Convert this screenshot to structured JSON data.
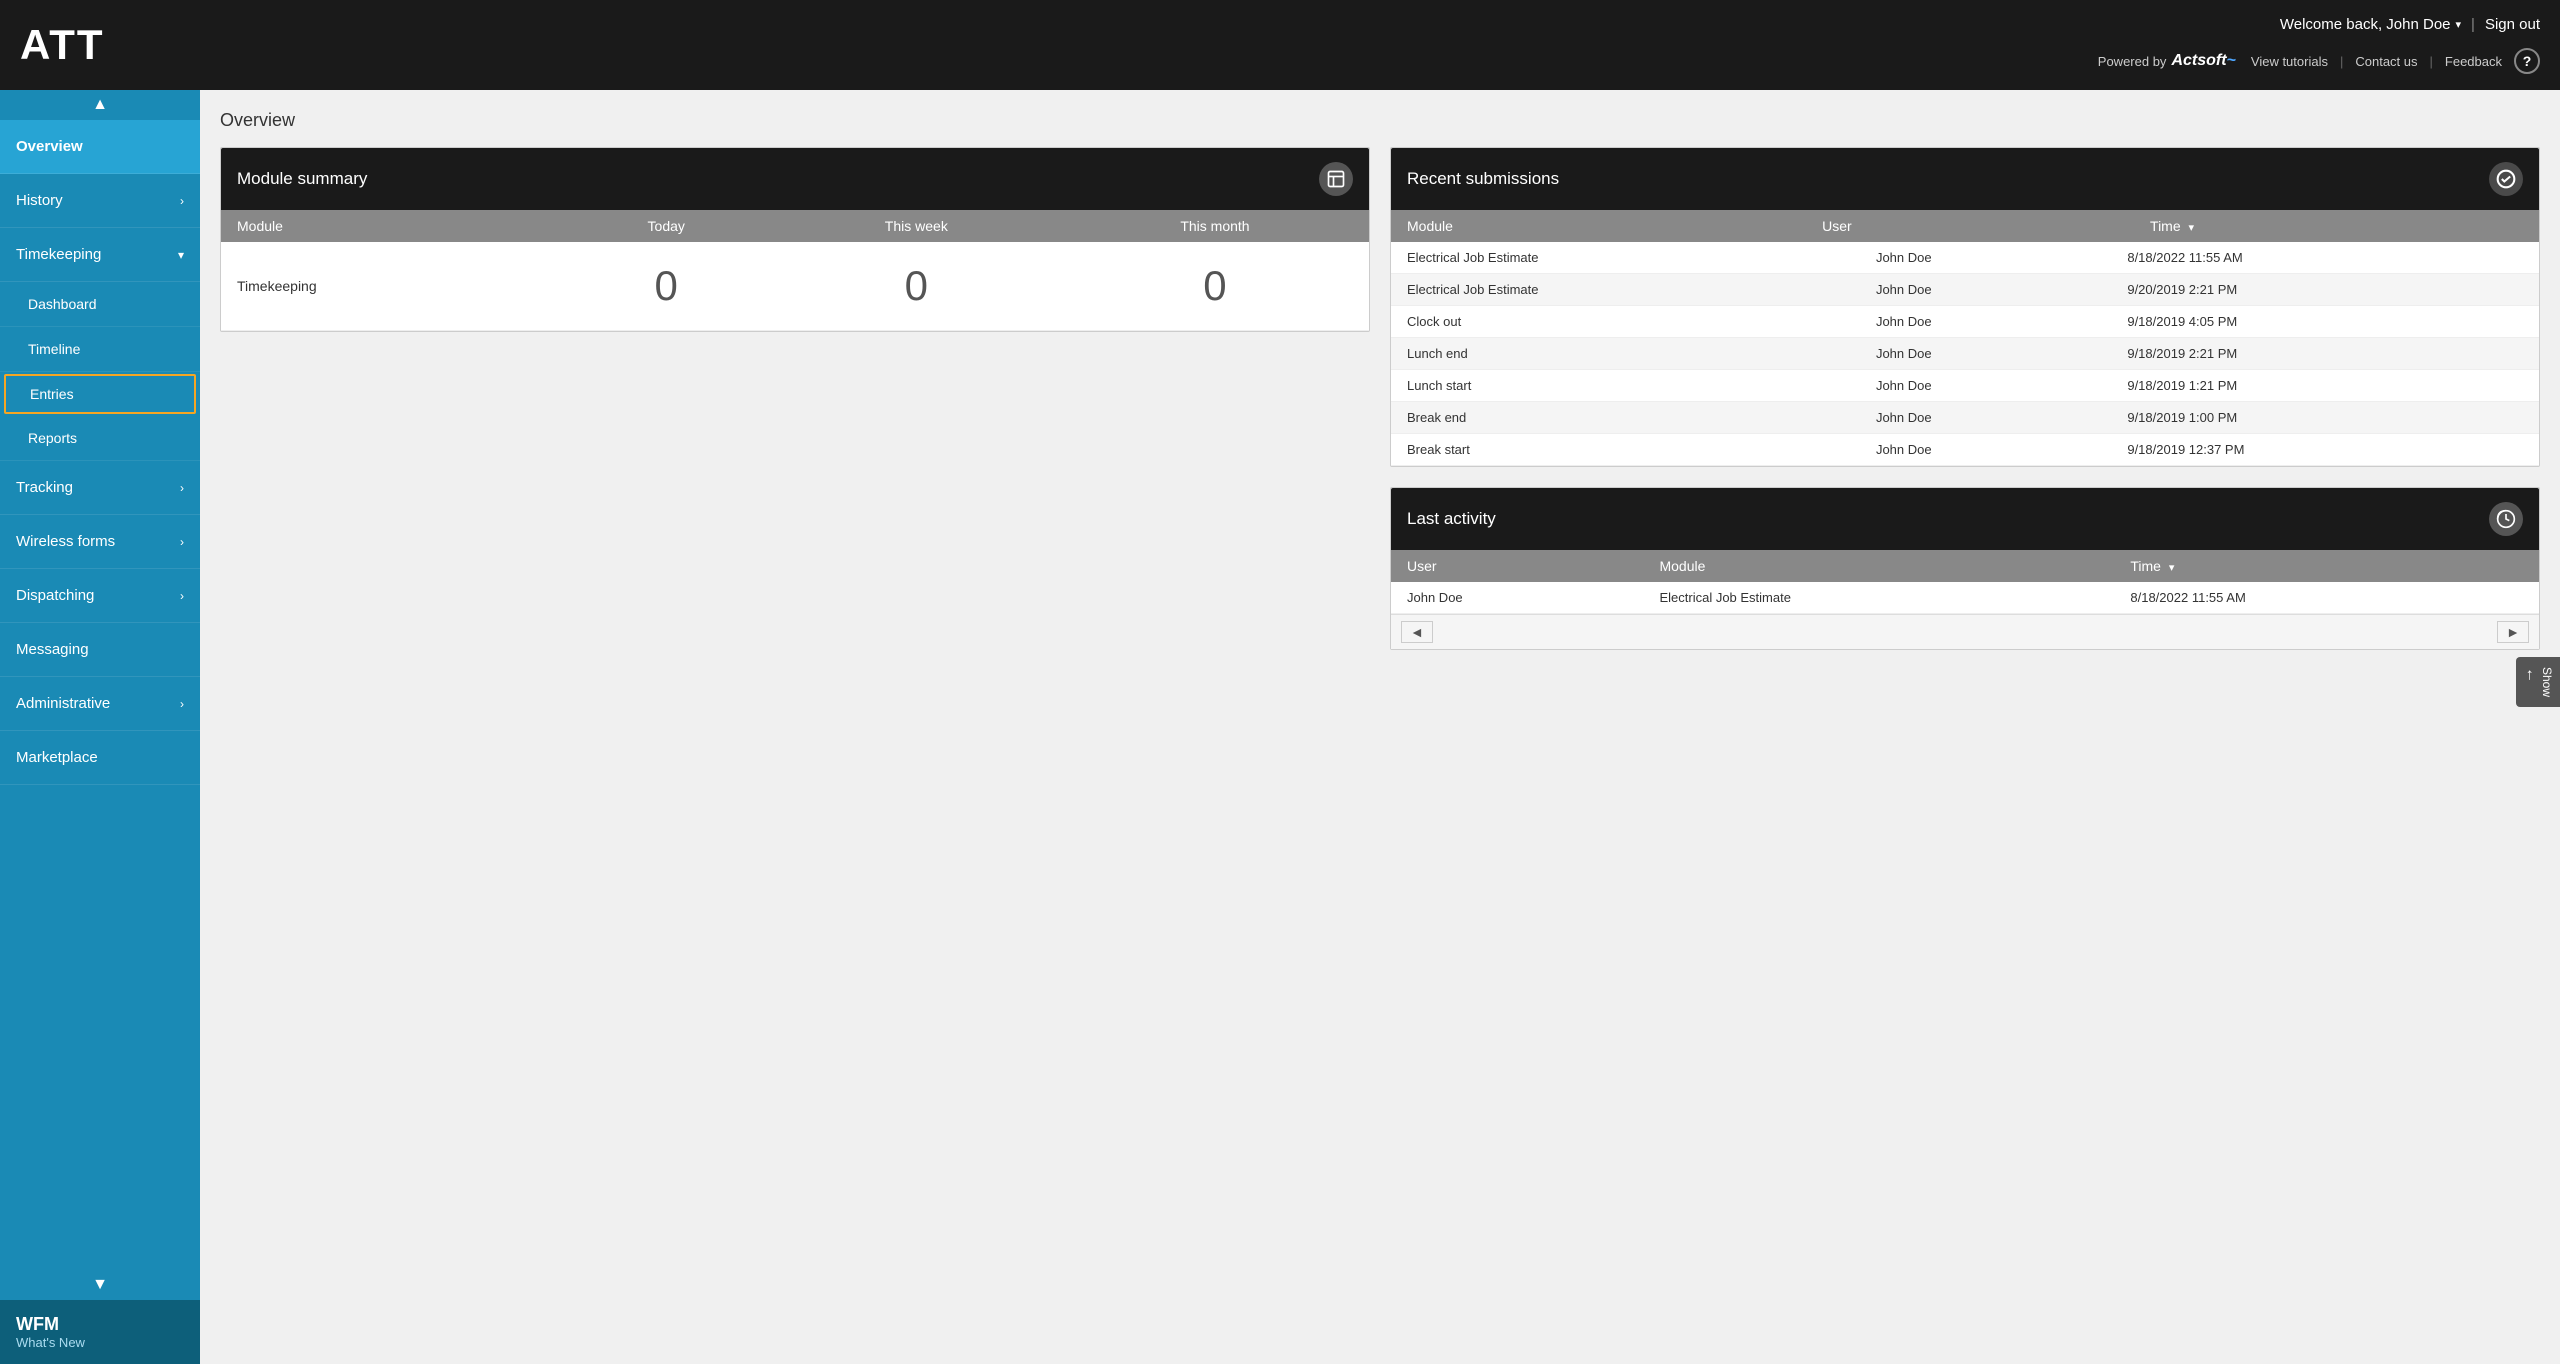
{
  "app": {
    "logo": "ATT",
    "powered_by": "Powered by",
    "actsoft": "Actsoft",
    "welcome": "Welcome back, John Doe",
    "sign_out": "Sign out",
    "view_tutorials": "View tutorials",
    "contact_us": "Contact us",
    "feedback": "Feedback"
  },
  "sidebar": {
    "scroll_up": "▲",
    "scroll_down": "▼",
    "items": [
      {
        "label": "Overview",
        "hasArrow": false,
        "active": true
      },
      {
        "label": "History",
        "hasArrow": true,
        "active": false
      },
      {
        "label": "Timekeeping",
        "hasArrow": true,
        "active": false,
        "expanded": true
      },
      {
        "label": "Tracking",
        "hasArrow": true,
        "active": false
      },
      {
        "label": "Wireless forms",
        "hasArrow": true,
        "active": false
      },
      {
        "label": "Dispatching",
        "hasArrow": true,
        "active": false
      },
      {
        "label": "Messaging",
        "hasArrow": false,
        "active": false
      },
      {
        "label": "Administrative",
        "hasArrow": true,
        "active": false
      },
      {
        "label": "Marketplace",
        "hasArrow": false,
        "active": false
      }
    ],
    "sub_items": [
      {
        "label": "Dashboard",
        "selected": false
      },
      {
        "label": "Timeline",
        "selected": false
      },
      {
        "label": "Entries",
        "selected": true
      },
      {
        "label": "Reports",
        "selected": false
      }
    ],
    "bottom": {
      "title": "WFM",
      "whats_new": "What's New"
    }
  },
  "main": {
    "page_title": "Overview",
    "module_summary": {
      "title": "Module summary",
      "columns": [
        "Module",
        "Today",
        "This week",
        "This month"
      ],
      "rows": [
        {
          "module": "Timekeeping",
          "today": "0",
          "this_week": "0",
          "this_month": "0"
        }
      ]
    },
    "recent_submissions": {
      "title": "Recent submissions",
      "columns": [
        "Module",
        "User",
        "Time"
      ],
      "sort_col": "Time",
      "rows": [
        {
          "module": "Electrical Job Estimate",
          "user": "John Doe",
          "time": "8/18/2022 11:55 AM"
        },
        {
          "module": "Electrical Job Estimate",
          "user": "John Doe",
          "time": "9/20/2019 2:21 PM"
        },
        {
          "module": "Clock out",
          "user": "John Doe",
          "time": "9/18/2019 4:05 PM"
        },
        {
          "module": "Lunch end",
          "user": "John Doe",
          "time": "9/18/2019 2:21 PM"
        },
        {
          "module": "Lunch start",
          "user": "John Doe",
          "time": "9/18/2019 1:21 PM"
        },
        {
          "module": "Break end",
          "user": "John Doe",
          "time": "9/18/2019 1:00 PM"
        },
        {
          "module": "Break start",
          "user": "John Doe",
          "time": "9/18/2019 12:37 PM"
        }
      ]
    },
    "last_activity": {
      "title": "Last activity",
      "columns": [
        "User",
        "Module",
        "Time"
      ],
      "sort_col": "Time",
      "rows": [
        {
          "user": "John Doe",
          "module": "Electrical Job Estimate",
          "time": "8/18/2022 11:55 AM"
        }
      ]
    }
  },
  "show_panel": {
    "arrow": "←",
    "label": "Show"
  }
}
